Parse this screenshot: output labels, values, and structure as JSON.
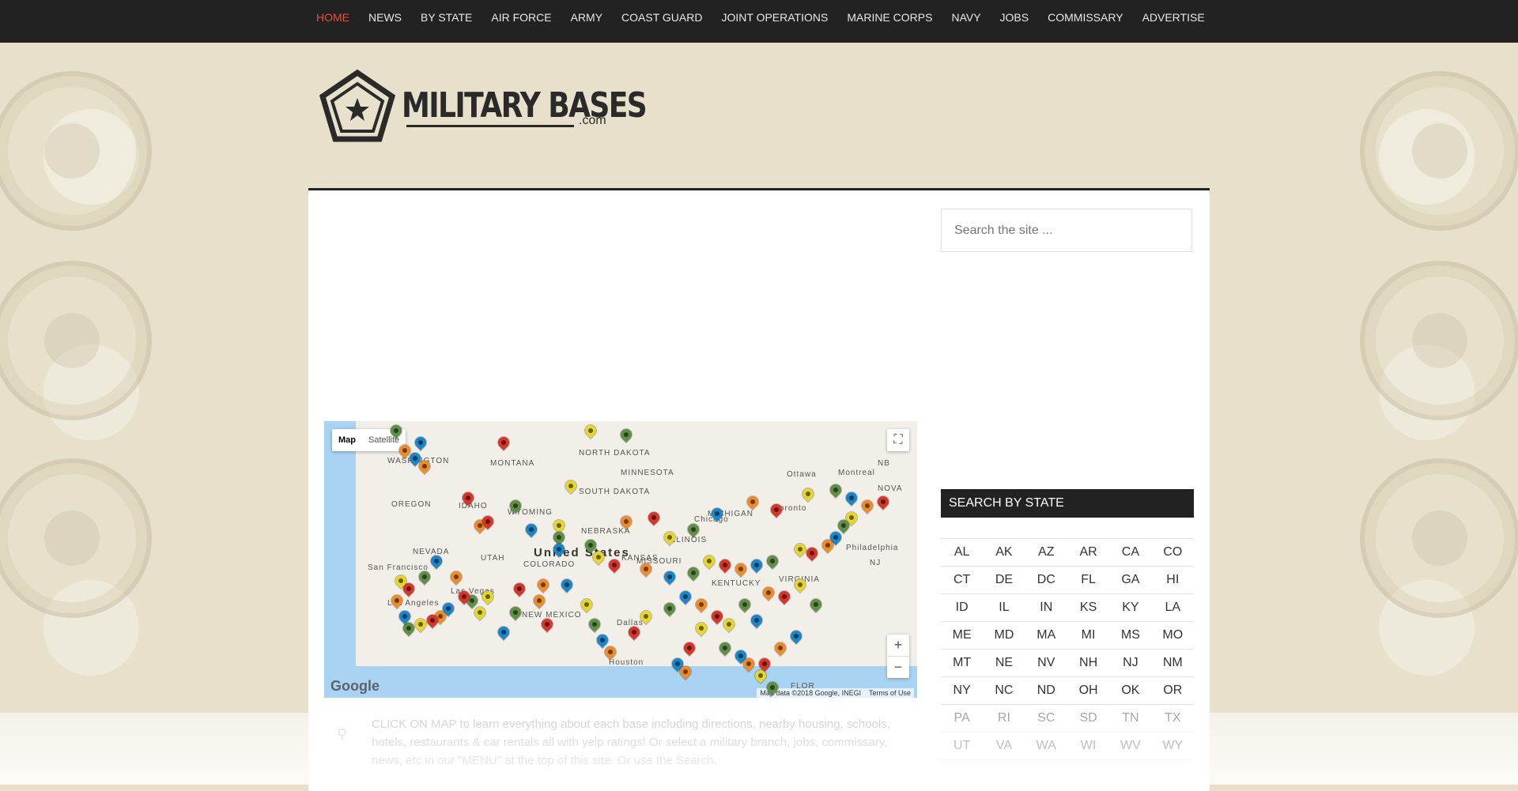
{
  "nav": {
    "items": [
      {
        "label": "HOME",
        "active": true
      },
      {
        "label": "NEWS"
      },
      {
        "label": "BY STATE"
      },
      {
        "label": "AIR FORCE"
      },
      {
        "label": "ARMY"
      },
      {
        "label": "COAST GUARD"
      },
      {
        "label": "JOINT OPERATIONS"
      },
      {
        "label": "MARINE CORPS"
      },
      {
        "label": "NAVY"
      },
      {
        "label": "JOBS"
      },
      {
        "label": "COMMISSARY"
      },
      {
        "label": "ADVERTISE"
      }
    ]
  },
  "logo": {
    "main": "MILITARY BASES",
    "sub": ".com"
  },
  "map": {
    "type_map": "Map",
    "type_satellite": "Satellite",
    "zoom_in": "+",
    "zoom_out": "−",
    "google_logo": "Google",
    "attribution": "Map data ©2018 Google, INEGI",
    "terms": "Terms of Use",
    "labels": [
      "WASHINGTON",
      "MONTANA",
      "NORTH DAKOTA",
      "MINNESOTA",
      "OREGON",
      "IDAHO",
      "SOUTH DAKOTA",
      "WYOMING",
      "NEBRASKA",
      "NEVADA",
      "UTAH",
      "COLORADO",
      "United States",
      "KANSAS",
      "MISSOURI",
      "ILLINOIS",
      "MICHIGAN",
      "Chicago",
      "Ottawa",
      "Montreal",
      "Toronto",
      "Philadelphia",
      "San Francisco",
      "Las Vegas",
      "Los Angeles",
      "NEW MEXICO",
      "Dallas",
      "Houston",
      "KENTUCKY",
      "VIRGINIA",
      "NJ",
      "NB",
      "NOVA",
      "FLOR"
    ],
    "pin_colors": {
      "army": "#5f8f45",
      "navy": "#1a86c9",
      "air_force": "#ef8a2b",
      "marine": "#d8352a",
      "coast_guard": "#e5d52d"
    }
  },
  "caption": "CLICK ON MAP to learn everything about each base including directions, nearby housing, schools, hotels, restaurants & car rentals all with yelp ratings! Or select a military branch, jobs, commissary, news, etc in our \"MENU\" at the top of this site. Or use the Search.",
  "search": {
    "placeholder": "Search the site ..."
  },
  "state_search": {
    "title": "SEARCH BY STATE",
    "rows": [
      [
        "AL",
        "AK",
        "AZ",
        "AR",
        "CA",
        "CO"
      ],
      [
        "CT",
        "DE",
        "DC",
        "FL",
        "GA",
        "HI"
      ],
      [
        "ID",
        "IL",
        "IN",
        "KS",
        "KY",
        "LA"
      ],
      [
        "ME",
        "MD",
        "MA",
        "MI",
        "MS",
        "MO"
      ],
      [
        "MT",
        "NE",
        "NV",
        "NH",
        "NJ",
        "NM"
      ],
      [
        "NY",
        "NC",
        "ND",
        "OH",
        "OK",
        "OR"
      ],
      [
        "PA",
        "RI",
        "SC",
        "SD",
        "TN",
        "TX"
      ],
      [
        "UT",
        "VA",
        "WA",
        "WI",
        "WV",
        "WY"
      ]
    ]
  }
}
